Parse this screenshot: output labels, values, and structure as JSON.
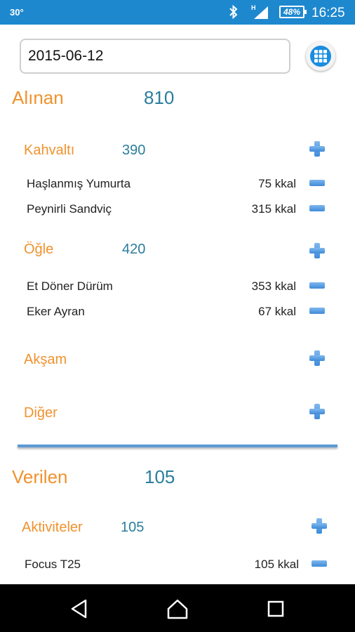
{
  "status_bar": {
    "temperature": "30°",
    "battery": "48%",
    "time": "16:25"
  },
  "date_field": {
    "value": "2015-06-12"
  },
  "alinan": {
    "label": "Alınan",
    "total": "810",
    "sections": [
      {
        "label": "Kahvaltı",
        "total": "390",
        "items": [
          {
            "name": "Haşlanmış Yumurta",
            "kcal": "75 kkal"
          },
          {
            "name": "Peynirli Sandviç",
            "kcal": "315 kkal"
          }
        ]
      },
      {
        "label": "Öğle",
        "total": "420",
        "items": [
          {
            "name": "Et Döner Dürüm",
            "kcal": "353 kkal"
          },
          {
            "name": "Eker Ayran",
            "kcal": "67 kkal"
          }
        ]
      },
      {
        "label": "Akşam",
        "total": "",
        "items": []
      },
      {
        "label": "Diğer",
        "total": "",
        "items": []
      }
    ]
  },
  "verilen": {
    "label": "Verilen",
    "total": "105",
    "sections": [
      {
        "label": "Aktiviteler",
        "total": "105",
        "items": [
          {
            "name": "Focus T25",
            "kcal": "105 kkal"
          }
        ]
      }
    ]
  },
  "colors": {
    "status_bar": "#1e88cf",
    "orange_label": "#f0922e",
    "teal_number": "#2a7e9c",
    "icon_blue": "#3f8bd8"
  },
  "icons": {
    "add": "plus-icon",
    "remove": "minus-icon",
    "calendar": "calendar-grid-icon"
  }
}
